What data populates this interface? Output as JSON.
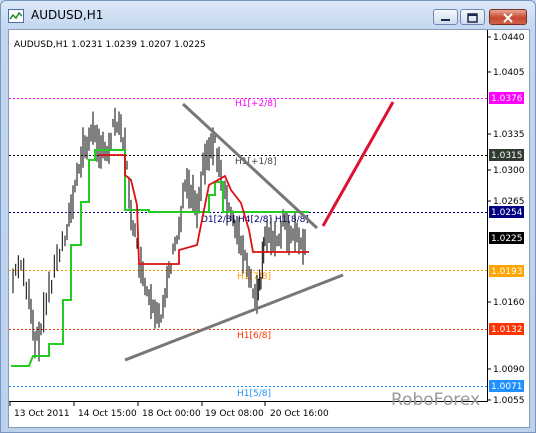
{
  "window": {
    "title": "AUDUSD,H1"
  },
  "chart_info": "AUDUSD,H1  1.0231 1.0239 1.0207 1.0225",
  "watermark": "RoboForex",
  "colors": {
    "bull_line": "#22cc22",
    "bear_line": "#dd1111",
    "trend_line": "#777777",
    "forecast_line": "#dd1133",
    "price_bars": "#000000"
  },
  "price_axis_ticks": [
    "1.0440",
    "1.0405",
    "1.0335",
    "1.0300",
    "1.0265",
    "1.0160",
    "1.0090",
    "1.0055"
  ],
  "time_axis_labels": [
    "13 Oct 2011",
    "14 Oct 15:00",
    "18 Oct 00:00",
    "19 Oct 08:00",
    "20 Oct 16:00"
  ],
  "levels": [
    {
      "label": "H1[+2/8]",
      "price": "1.0376",
      "color": "#ff00ff",
      "tag_bg": "#ff00ff",
      "tag_fg": "#ffffff"
    },
    {
      "label": "H1[+1/8]",
      "price": "1.0315",
      "color": "#000000",
      "tag_bg": "#303a30",
      "tag_fg": "#ffffff"
    },
    {
      "label": "D1[2/8] H4[2/8] H1[8/8]",
      "price": "1.0254",
      "color": "#000080",
      "tag_bg": "#000080",
      "tag_fg": "#ffffff"
    },
    {
      "label": "H1[7/8]",
      "price": "1.0193",
      "color": "#ff9900",
      "tag_bg": "#ffa500",
      "tag_fg": "#ffffff"
    },
    {
      "label": "H1[6/8]",
      "price": "1.0132",
      "color": "#ff3300",
      "tag_bg": "#ff3300",
      "tag_fg": "#ffffff"
    },
    {
      "label": "H1[5/8]",
      "price": "1.0071",
      "color": "#1e90ff",
      "tag_bg": "#1e90ff",
      "tag_fg": "#ffffff"
    }
  ],
  "current_price": "1.0225"
}
